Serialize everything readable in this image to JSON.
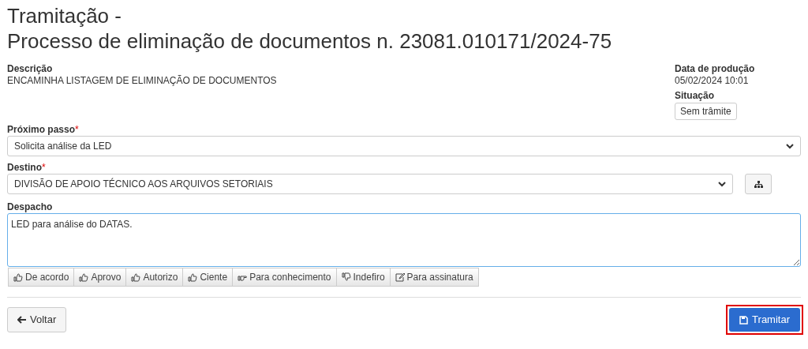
{
  "title_lines": [
    "Tramitação -",
    "Processo de eliminação de documentos n. 23081.010171/2024-75"
  ],
  "descricao": {
    "label": "Descrição",
    "value": "ENCAMINHA LISTAGEM DE ELIMINAÇÃO DE DOCUMENTOS"
  },
  "data_producao": {
    "label": "Data de produção",
    "value": "05/02/2024 10:01"
  },
  "situacao": {
    "label": "Situação",
    "value": "Sem trâmite"
  },
  "proximo_passo": {
    "label": "Próximo passo",
    "required_mark": "*",
    "value": "Solicita análise da LED"
  },
  "destino": {
    "label": "Destino",
    "required_mark": "*",
    "value": "DIVISÃO DE APOIO TÉCNICO AOS ARQUIVOS SETORIAIS"
  },
  "despacho": {
    "label": "Despacho",
    "value": "LED para análise do DATAS."
  },
  "quick_buttons": [
    {
      "kind": "like",
      "label": "De acordo"
    },
    {
      "kind": "like",
      "label": "Aprovo"
    },
    {
      "kind": "like",
      "label": "Autorizo"
    },
    {
      "kind": "like",
      "label": "Ciente"
    },
    {
      "kind": "point",
      "label": "Para conhecimento"
    },
    {
      "kind": "dislike",
      "label": "Indefiro"
    },
    {
      "kind": "edit",
      "label": "Para assinatura"
    }
  ],
  "back_button": {
    "label": "Voltar"
  },
  "submit_button": {
    "label": "Tramitar",
    "highlighted": true
  }
}
